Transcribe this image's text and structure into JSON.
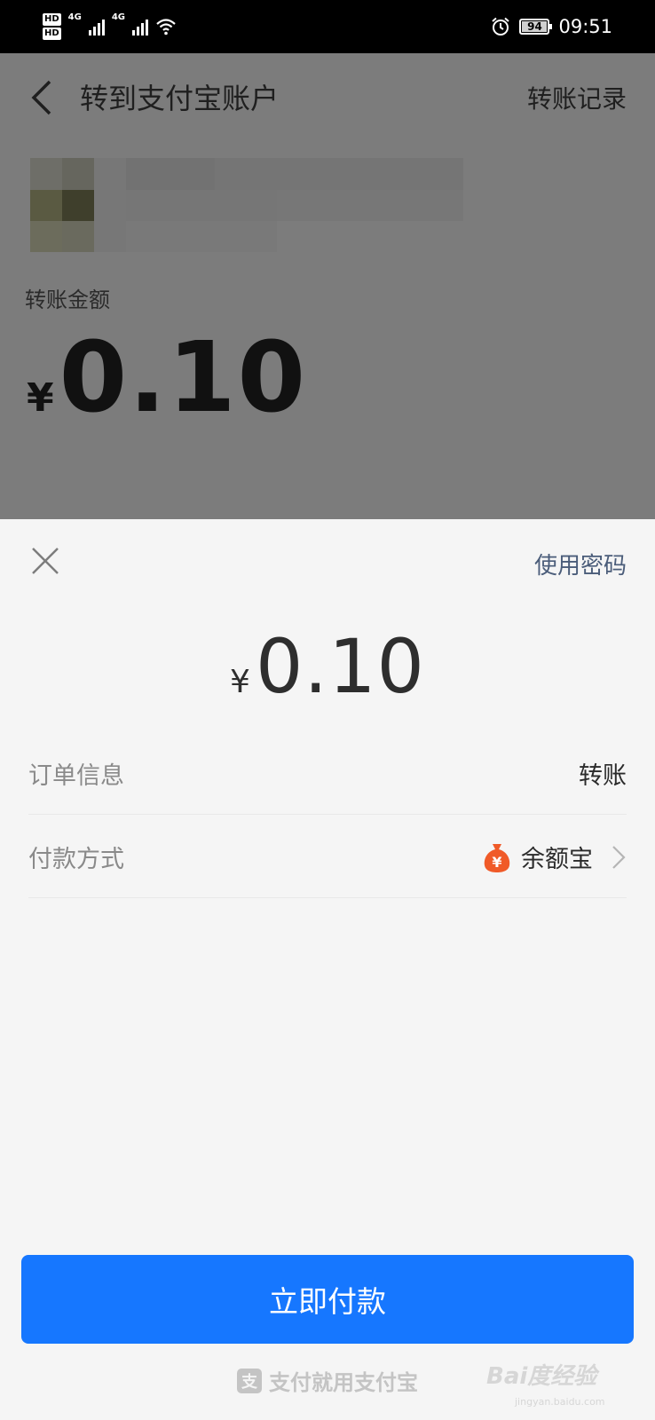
{
  "status_bar": {
    "hd1": "HD",
    "hd2": "HD",
    "net1": "4G",
    "net2": "4G",
    "battery": "94",
    "time": "09:51"
  },
  "header": {
    "title": "转到支付宝账户",
    "action": "转账记录"
  },
  "transfer": {
    "amount_label": "转账金额",
    "currency": "¥",
    "amount": "0.10"
  },
  "sheet": {
    "use_password": "使用密码",
    "currency": "¥",
    "amount": "0.10",
    "rows": [
      {
        "label": "订单信息",
        "value": "转账"
      },
      {
        "label": "付款方式",
        "value": "余额宝",
        "icon": "yuebao-moneybag-icon"
      }
    ],
    "pay_button": "立即付款",
    "footer_text": "支付就用支付宝",
    "footer_logo": "支"
  },
  "watermark": {
    "text": "Bai度经验",
    "url": "jingyan.baidu.com"
  },
  "colors": {
    "primary_button": "#1677ff",
    "link": "#4b5d7a",
    "yuebao_orange": "#f05a28",
    "overlay": "#7c7c7c"
  }
}
